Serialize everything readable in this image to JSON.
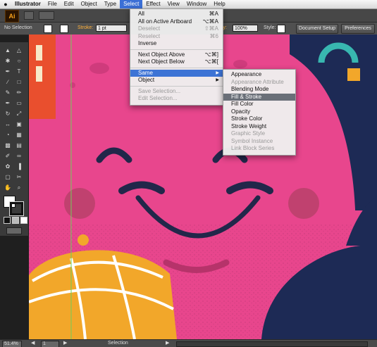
{
  "menubar": {
    "apple": "",
    "items": [
      {
        "label": "Illustrator"
      },
      {
        "label": "File"
      },
      {
        "label": "Edit"
      },
      {
        "label": "Object"
      },
      {
        "label": "Type"
      },
      {
        "label": "Select"
      },
      {
        "label": "Effect"
      },
      {
        "label": "View"
      },
      {
        "label": "Window"
      },
      {
        "label": "Help"
      }
    ]
  },
  "appbar": {
    "logo": "Ai"
  },
  "controlbar": {
    "selection_status": "No Selection",
    "stroke_label": "Stroke:",
    "stroke_value": "1 pt",
    "opacity_label": "ity:",
    "opacity_value": "100%",
    "style_label": "Style:",
    "document_setup": "Document Setup",
    "preferences": "Preferences"
  },
  "select_menu": {
    "items": [
      {
        "label": "All",
        "shortcut": "⌘A"
      },
      {
        "label": "All on Active Artboard",
        "shortcut": "⌥⌘A"
      },
      {
        "label": "Deselect",
        "shortcut": "⇧⌘A"
      },
      {
        "label": "Reselect",
        "shortcut": "⌘6"
      },
      {
        "label": "Inverse",
        "shortcut": ""
      },
      {
        "label": "Next Object Above",
        "shortcut": "⌥⌘]"
      },
      {
        "label": "Next Object Below",
        "shortcut": "⌥⌘["
      },
      {
        "label": "Same",
        "shortcut": ""
      },
      {
        "label": "Object",
        "shortcut": ""
      },
      {
        "label": "Save Selection...",
        "shortcut": ""
      },
      {
        "label": "Edit Selection...",
        "shortcut": ""
      }
    ]
  },
  "same_submenu": {
    "items": [
      {
        "label": "Appearance"
      },
      {
        "label": "Appearance Attribute"
      },
      {
        "label": "Blending Mode"
      },
      {
        "label": "Fill & Stroke"
      },
      {
        "label": "Fill Color"
      },
      {
        "label": "Opacity"
      },
      {
        "label": "Stroke Color"
      },
      {
        "label": "Stroke Weight"
      },
      {
        "label": "Graphic Style"
      },
      {
        "label": "Symbol Instance"
      },
      {
        "label": "Link Block Series"
      }
    ]
  },
  "status": {
    "zoom": "51.4%",
    "page": "1",
    "tool": "Selection"
  },
  "colors": {
    "accent": "#3d73d5",
    "canvas_pink": "#e8468d",
    "face_navy": "#22274a",
    "cheek": "#c0416f",
    "dome_orange": "#f2a72a"
  },
  "icons": {
    "apple": "apple-icon",
    "submenu": "chevron-right-icon"
  }
}
